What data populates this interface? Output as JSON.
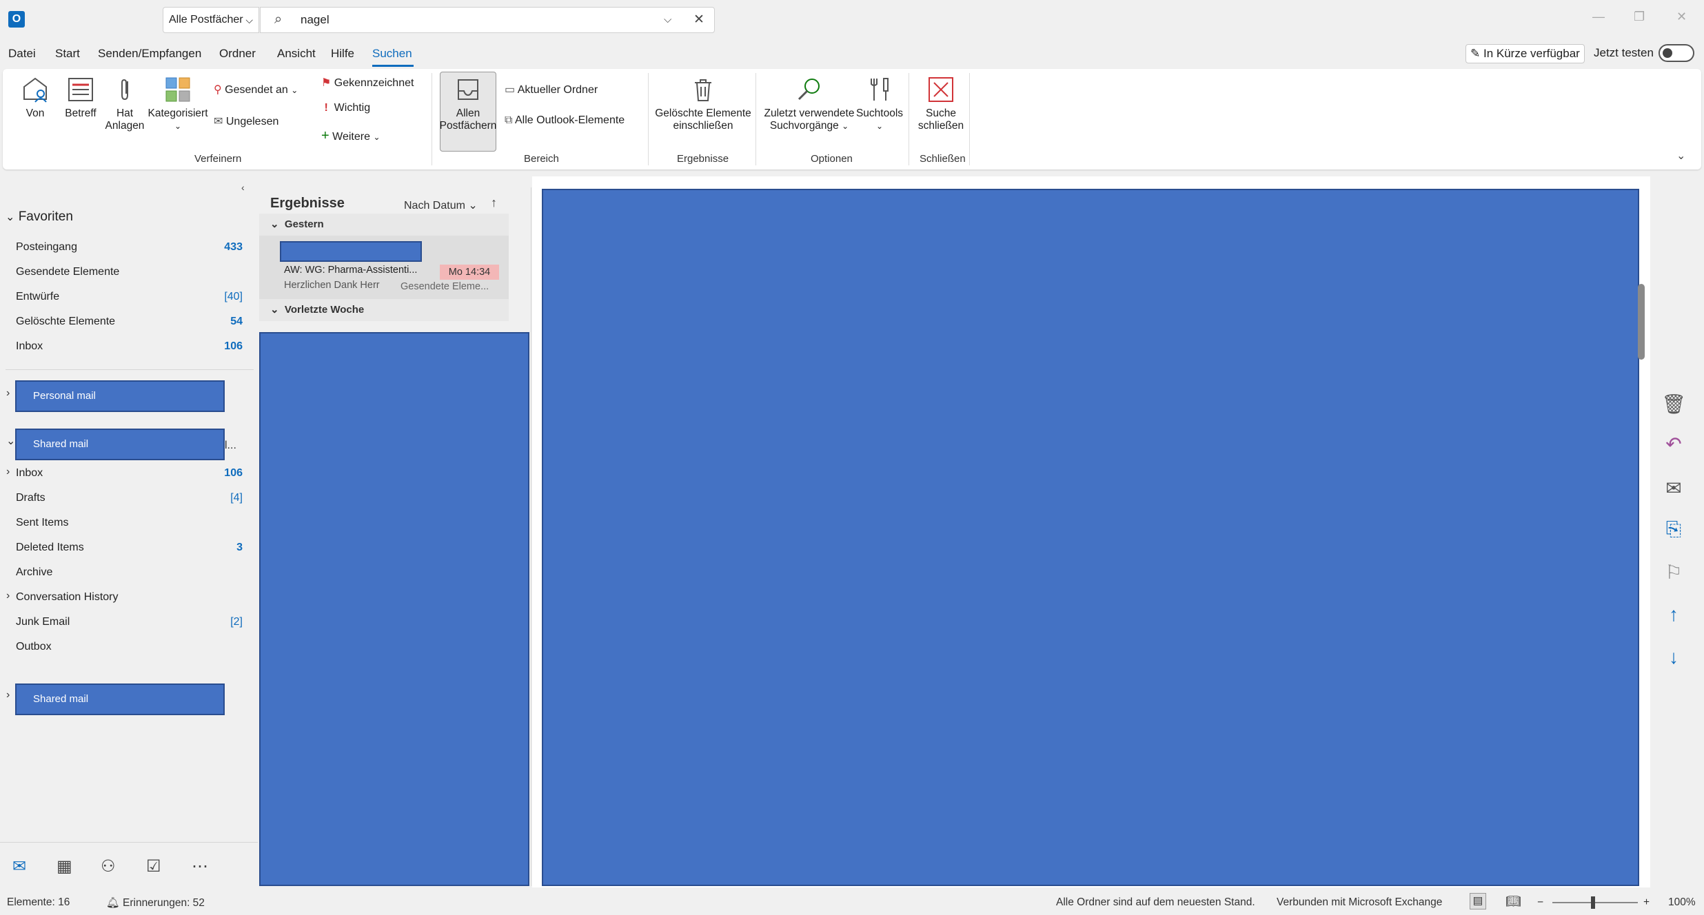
{
  "titlebar": {
    "scope": "Alle Postfächer",
    "search_value": "nagel",
    "icons": [
      "outlook-logo",
      "search-icon",
      "chevron-down-icon",
      "close-icon",
      "minimize-icon",
      "restore-icon",
      "close-window-icon"
    ]
  },
  "menu": {
    "items": [
      "Datei",
      "Start",
      "Senden/Empfangen",
      "Ordner",
      "Ansicht",
      "Hilfe",
      "Suchen"
    ],
    "active": "Suchen",
    "coming_soon": "In Kürze verfügbar",
    "try_now": "Jetzt testen"
  },
  "ribbon": {
    "von": "Von",
    "betreff": "Betreff",
    "hat_anlagen_1": "Hat",
    "hat_anlagen_2": "Anlagen",
    "kategorisiert": "Kategorisiert",
    "gesendet_an": "Gesendet an",
    "ungelesen": "Ungelesen",
    "gekennzeichnet": "Gekennzeichnet",
    "wichtig": "Wichtig",
    "weitere": "Weitere",
    "group_verfeinern": "Verfeinern",
    "allen_1": "Allen",
    "allen_2": "Postfächern",
    "aktueller_ordner": "Aktueller Ordner",
    "alle_outlook": "Alle Outlook-Elemente",
    "group_bereich": "Bereich",
    "geloeschte_1": "Gelöschte Elemente",
    "geloeschte_2": "einschließen",
    "group_ergebnisse": "Ergebnisse",
    "zuletzt_1": "Zuletzt verwendete",
    "zuletzt_2": "Suchvorgänge",
    "suchtools": "Suchtools",
    "group_optionen": "Optionen",
    "suche_1": "Suche",
    "suche_2": "schließen",
    "group_schliessen": "Schließen",
    "accent_red": "#d13438",
    "accent_green": "#107c10"
  },
  "favorites": {
    "heading": "Favoriten",
    "items": [
      {
        "label": "Posteingang",
        "count": "433"
      },
      {
        "label": "Gesendete Elemente",
        "count": ""
      },
      {
        "label": "Entwürfe",
        "count": "[40]"
      },
      {
        "label": "Gelöschte Elemente",
        "count": "54"
      },
      {
        "label": "Inbox",
        "count": "106"
      }
    ]
  },
  "accounts": {
    "personal": "Personal mail",
    "shared": "Shared mail",
    "shared_truncation": "l...",
    "shared_folders": [
      {
        "label": "Inbox",
        "count": "106"
      },
      {
        "label": "Drafts",
        "count": "[4]"
      },
      {
        "label": "Sent Items",
        "count": ""
      },
      {
        "label": "Deleted Items",
        "count": "3"
      },
      {
        "label": "Archive",
        "count": ""
      },
      {
        "label": "Conversation History",
        "count": ""
      },
      {
        "label": "Junk Email",
        "count": "[2]"
      },
      {
        "label": "Outbox",
        "count": ""
      }
    ],
    "shared2": "Shared mail"
  },
  "results": {
    "title": "Ergebnisse",
    "sort": "Nach Datum",
    "group_yesterday": "Gestern",
    "group_prev_week": "Vorletzte Woche",
    "mail": {
      "subject": "AW: WG: Pharma-Assistenti...",
      "time": "Mo 14:34",
      "preview": "Herzlichen Dank Herr",
      "folder": "Gesendete Eleme..."
    }
  },
  "status": {
    "items": "Elemente: 16",
    "reminders": "Erinnerungen: 52",
    "sync": "Alle Ordner sind auf dem neuesten Stand.",
    "connection": "Verbunden mit Microsoft Exchange",
    "zoom": "100%"
  },
  "colors": {
    "accent": "#0f6cbd",
    "redaction": "#4472c4"
  }
}
